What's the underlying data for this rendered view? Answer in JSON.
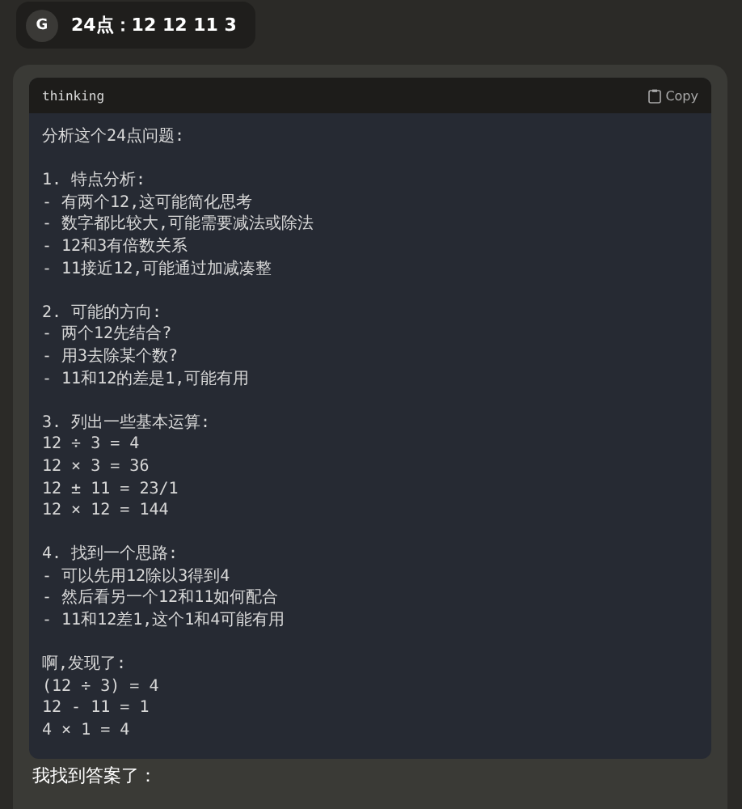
{
  "user_message": {
    "avatar": "G",
    "text": "24点：12 12 11 3"
  },
  "code_block": {
    "language": "thinking",
    "copy_label": "Copy",
    "paragraphs": [
      [
        "分析这个24点问题:"
      ],
      [
        "1. 特点分析:",
        "- 有两个12,这可能简化思考",
        "- 数字都比较大,可能需要减法或除法",
        "- 12和3有倍数关系",
        "- 11接近12,可能通过加减凑整"
      ],
      [
        "2. 可能的方向:",
        "- 两个12先结合?",
        "- 用3去除某个数?",
        "- 11和12的差是1,可能有用"
      ],
      [
        "3. 列出一些基本运算:",
        "12 ÷ 3 = 4",
        "12 × 3 = 36",
        "12 ± 11 = 23/1",
        "12 × 12 = 144"
      ],
      [
        "4. 找到一个思路:",
        "- 可以先用12除以3得到4",
        "- 然后看另一个12和11如何配合",
        "- 11和12差1,这个1和4可能有用"
      ],
      [
        "啊,发现了:",
        "(12 ÷ 3) = 4",
        "12 - 11 = 1",
        "4 × 1 = 4"
      ]
    ]
  },
  "answer_text": "我找到答案了："
}
